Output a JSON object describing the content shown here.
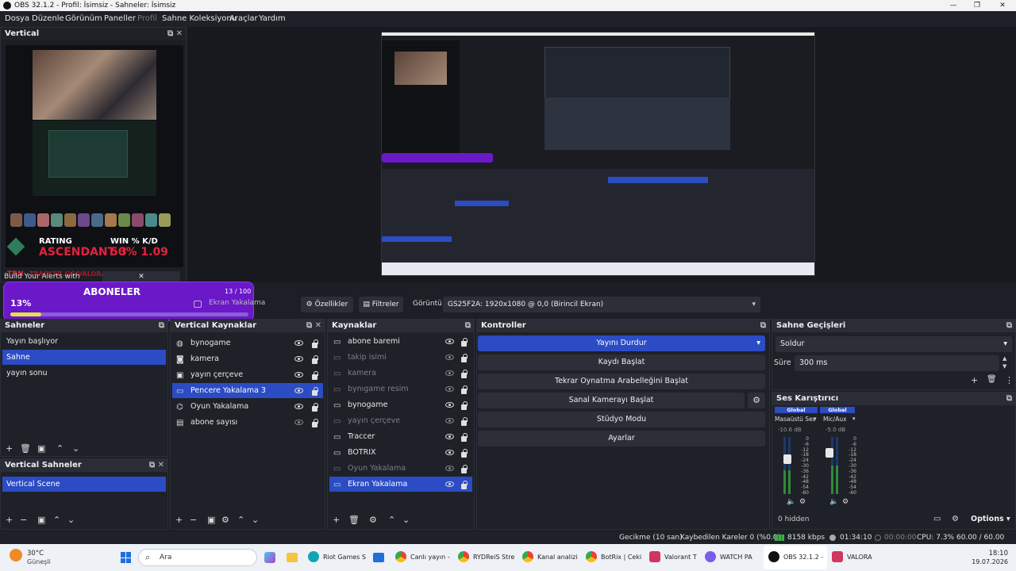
{
  "window": {
    "title": "OBS 32.1.2 - Profil: İsimsiz - Sahneler: İsimsiz",
    "controls": [
      "—",
      "❐",
      "✕"
    ]
  },
  "menu": [
    "Dosya",
    "Düzenle",
    "Görünüm",
    "Paneller",
    "Profil",
    "Sahne Koleksiyonu",
    "Araçlar",
    "Yardım"
  ],
  "vertical_dock": {
    "title": "Vertical",
    "rating_label": "RATING",
    "rank": "ASCENDANT 3",
    "winkd": "WIN % K/D",
    "winkd_values": "50% 1.09",
    "tracker": "TRACKER.GG/VALORANT",
    "trn": "TRN",
    "alert_banner": "Build Your Alerts with Aitum",
    "alert_close": "✕"
  },
  "overlay": {
    "title": "ABONELER",
    "count": "13 / 100",
    "percent": "13%",
    "progress": 0.13
  },
  "source_bar": {
    "selected_source": "Ekran Yakalama",
    "properties": "Özellikler",
    "filters": "Filtreler",
    "display_label": "Görüntü",
    "display_value": "GS25F2A: 1920x1080 @ 0,0 (Birincil Ekran)"
  },
  "scenes": {
    "title": "Sahneler",
    "items": [
      "Yayın başlıyor",
      "Sahne",
      "yayın sonu"
    ],
    "selected": 1
  },
  "vertical_scenes": {
    "title": "Vertical Sahneler",
    "items": [
      "Vertical Scene"
    ]
  },
  "vertical_sources": {
    "title": "Vertical Kaynaklar",
    "items": [
      {
        "name": "bynogame",
        "icon": "browser-icon"
      },
      {
        "name": "kamera",
        "icon": "camera-icon"
      },
      {
        "name": "yayın çerçeve",
        "icon": "image-icon"
      },
      {
        "name": "Pencere Yakalama 3",
        "icon": "window-icon"
      },
      {
        "name": "Oyun Yakalama",
        "icon": "gamepad-icon"
      },
      {
        "name": "abone sayısı",
        "icon": "text-icon"
      }
    ],
    "selected": 3
  },
  "sources": {
    "title": "Kaynaklar",
    "items": [
      {
        "name": "abone baremi",
        "dim": false
      },
      {
        "name": "takip isimi",
        "dim": true
      },
      {
        "name": "kamera",
        "dim": true
      },
      {
        "name": "bynıgame resim",
        "dim": true
      },
      {
        "name": "bynogame",
        "dim": false
      },
      {
        "name": "yayın çerçeve",
        "dim": true
      },
      {
        "name": "Traccer",
        "dim": false
      },
      {
        "name": "BOTRIX",
        "dim": false
      },
      {
        "name": "Oyun Yakalama",
        "dim": true
      },
      {
        "name": "Ekran Yakalama",
        "dim": false
      }
    ],
    "selected": 9
  },
  "controls": {
    "title": "Kontroller",
    "buttons": [
      "Yayını Durdur",
      "Kaydı Başlat",
      "Tekrar Oynatma Arabelleğini Başlat",
      "Sanal Kamerayı Başlat",
      "Stüdyo Modu",
      "Ayarlar"
    ]
  },
  "transitions": {
    "title": "Sahne Geçişleri",
    "type": "Soldur",
    "duration_label": "Süre",
    "duration": "300 ms"
  },
  "mixer": {
    "title": "Ses Karıştırıcı",
    "channels": [
      {
        "global": "Global",
        "name": "Masaüstü Ses",
        "db": "-10.6 dB",
        "level": 0.42
      },
      {
        "global": "Global",
        "name": "Mic/Aux",
        "db": "-5.0 dB",
        "level": 0.5
      }
    ],
    "scale": [
      "0",
      "-6",
      "-12",
      "-18",
      "-24",
      "-30",
      "-36",
      "-42",
      "-48",
      "-54",
      "-60"
    ],
    "hidden_label": "0 hidden",
    "options": "Options"
  },
  "status": {
    "delay": "Gecikme (10 san)",
    "dropped": "Kaybedilen Kareler 0 (%0.0)",
    "bitrate": "8158 kbps",
    "live_time": "01:34:10",
    "rec_time": "00:00:00",
    "cpu": "CPU: 7.3%",
    "fps": "60.00 / 60.00 FPS"
  },
  "taskbar": {
    "weather_temp": "30°C",
    "weather_desc": "Güneşli",
    "search": "Ara",
    "tasks": [
      "Riot Games S",
      "Canlı yayın -",
      "RYDReiS Stre",
      "Kanal analizi",
      "BotRix | Ceki",
      "Valorant T",
      "WATCH PA",
      "OBS 32.1.2 -",
      "VALORA"
    ],
    "time": "18:10",
    "date": "19.07.2026"
  },
  "colors": {
    "accent": "#2b4cc4",
    "overlay": "#6a18c8",
    "overlay_bar": "#e4e14a"
  }
}
